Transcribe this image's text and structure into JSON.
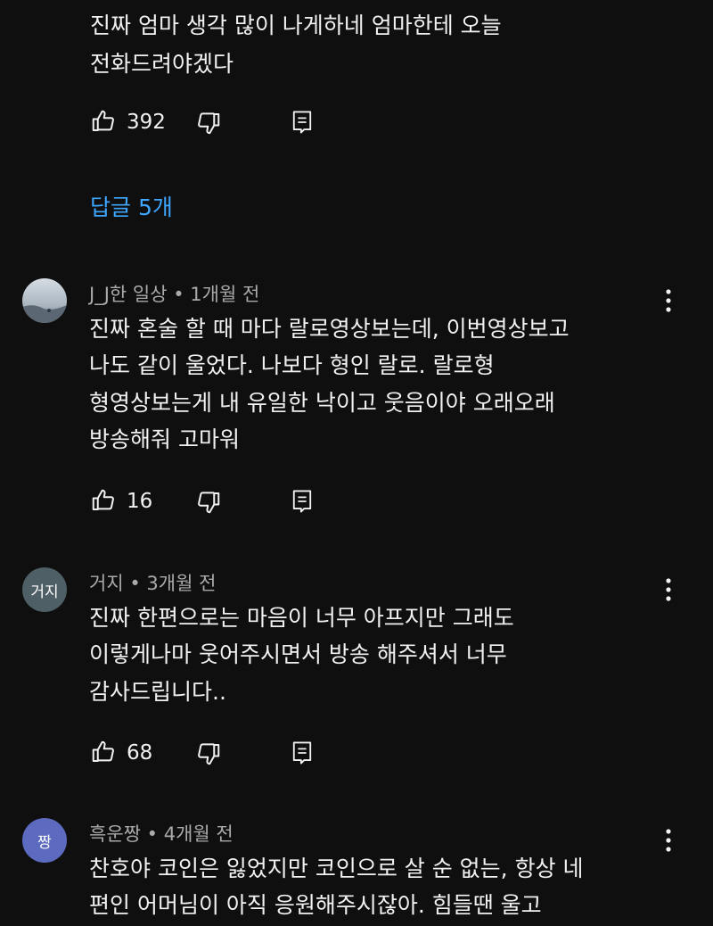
{
  "top_comment": {
    "lines": [
      "진짜 엄마 생각 많이 나게하네 엄마한테 오늘",
      "전화드려야겠다"
    ],
    "likes": "392",
    "replies_label": "답글 5개"
  },
  "comments": [
    {
      "author": "J_J한 일상",
      "time": "1개월 전",
      "avatar_text": "",
      "avatar_color": "#b9c3cc",
      "lines": [
        "진짜 혼술 할 때 마다 랄로영상보는데, 이번영상보고",
        "나도 같이 울었다. 나보다 형인 랄로. 랄로형",
        "형영상보는게 내 유일한 낙이고 웃음이야 오래오래",
        "방송해줘 고마워"
      ],
      "likes": "16"
    },
    {
      "author": "거지",
      "time": "3개월 전",
      "avatar_text": "거지",
      "avatar_color": "#4f5f66",
      "lines": [
        "진짜 한편으로는 마음이 너무 아프지만 그래도",
        "이렇게나마 웃어주시면서 방송 해주셔서 너무",
        "감사드립니다.."
      ],
      "likes": "68"
    },
    {
      "author": "흑운짱",
      "time": "4개월 전",
      "avatar_text": "짱",
      "avatar_color": "#5c6bc0",
      "lines": [
        "찬호야 코인은 잃었지만 코인으로 살 순 없는, 항상 네",
        "편인 어머님이 아직 응원해주시잖아. 힘들땐 울고"
      ]
    }
  ]
}
